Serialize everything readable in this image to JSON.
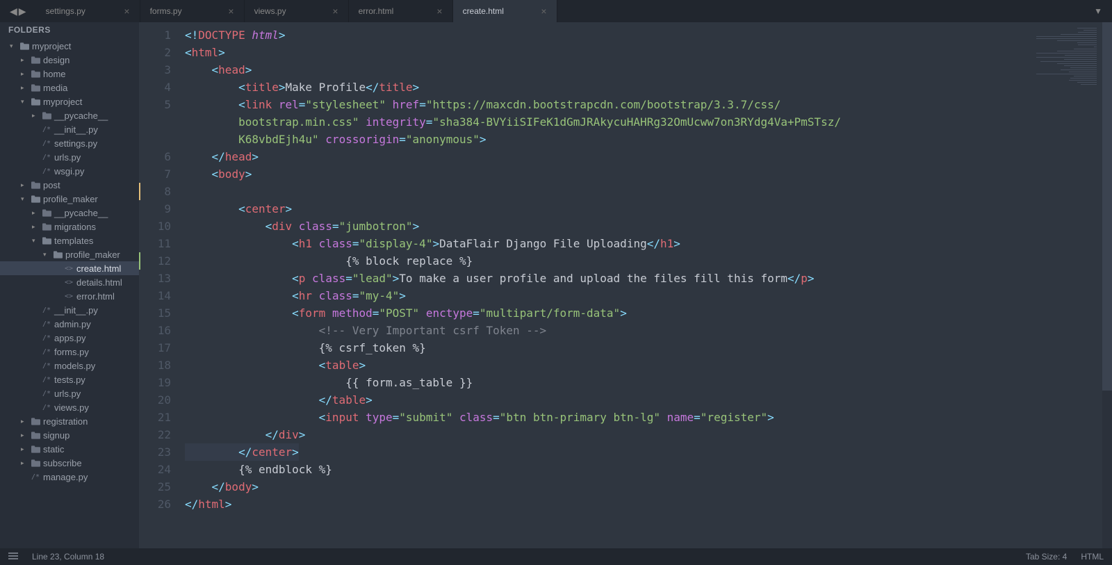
{
  "sidebar_title": "FOLDERS",
  "tabs": [
    {
      "label": "settings.py",
      "active": false
    },
    {
      "label": "forms.py",
      "active": false
    },
    {
      "label": "views.py",
      "active": false
    },
    {
      "label": "error.html",
      "active": false
    },
    {
      "label": "create.html",
      "active": true
    }
  ],
  "tree": [
    {
      "indent": 0,
      "arrow": "▾",
      "type": "folder-open",
      "label": "myproject"
    },
    {
      "indent": 1,
      "arrow": "▸",
      "type": "folder",
      "label": "design"
    },
    {
      "indent": 1,
      "arrow": "▸",
      "type": "folder",
      "label": "home"
    },
    {
      "indent": 1,
      "arrow": "▸",
      "type": "folder",
      "label": "media"
    },
    {
      "indent": 1,
      "arrow": "▾",
      "type": "folder-open",
      "label": "myproject"
    },
    {
      "indent": 2,
      "arrow": "▸",
      "type": "folder",
      "label": "__pycache__"
    },
    {
      "indent": 2,
      "arrow": "",
      "type": "py",
      "label": "__init__.py"
    },
    {
      "indent": 2,
      "arrow": "",
      "type": "py",
      "label": "settings.py"
    },
    {
      "indent": 2,
      "arrow": "",
      "type": "py",
      "label": "urls.py"
    },
    {
      "indent": 2,
      "arrow": "",
      "type": "py",
      "label": "wsgi.py"
    },
    {
      "indent": 1,
      "arrow": "▸",
      "type": "folder",
      "label": "post"
    },
    {
      "indent": 1,
      "arrow": "▾",
      "type": "folder-open",
      "label": "profile_maker"
    },
    {
      "indent": 2,
      "arrow": "▸",
      "type": "folder",
      "label": "__pycache__"
    },
    {
      "indent": 2,
      "arrow": "▸",
      "type": "folder",
      "label": "migrations"
    },
    {
      "indent": 2,
      "arrow": "▾",
      "type": "folder-open",
      "label": "templates"
    },
    {
      "indent": 3,
      "arrow": "▾",
      "type": "folder-open",
      "label": "profile_maker"
    },
    {
      "indent": 4,
      "arrow": "",
      "type": "html",
      "label": "create.html",
      "selected": true
    },
    {
      "indent": 4,
      "arrow": "",
      "type": "html",
      "label": "details.html"
    },
    {
      "indent": 4,
      "arrow": "",
      "type": "html",
      "label": "error.html"
    },
    {
      "indent": 2,
      "arrow": "",
      "type": "py",
      "label": "__init__.py"
    },
    {
      "indent": 2,
      "arrow": "",
      "type": "py",
      "label": "admin.py"
    },
    {
      "indent": 2,
      "arrow": "",
      "type": "py",
      "label": "apps.py"
    },
    {
      "indent": 2,
      "arrow": "",
      "type": "py",
      "label": "forms.py"
    },
    {
      "indent": 2,
      "arrow": "",
      "type": "py",
      "label": "models.py"
    },
    {
      "indent": 2,
      "arrow": "",
      "type": "py",
      "label": "tests.py"
    },
    {
      "indent": 2,
      "arrow": "",
      "type": "py",
      "label": "urls.py"
    },
    {
      "indent": 2,
      "arrow": "",
      "type": "py",
      "label": "views.py"
    },
    {
      "indent": 1,
      "arrow": "▸",
      "type": "folder",
      "label": "registration"
    },
    {
      "indent": 1,
      "arrow": "▸",
      "type": "folder",
      "label": "signup"
    },
    {
      "indent": 1,
      "arrow": "▸",
      "type": "folder",
      "label": "static"
    },
    {
      "indent": 1,
      "arrow": "▸",
      "type": "folder",
      "label": "subscribe"
    },
    {
      "indent": 1,
      "arrow": "",
      "type": "py",
      "label": "manage.py"
    }
  ],
  "line_count": 26,
  "gutter_marks": {
    "8": "yellow",
    "12": "green"
  },
  "highlight_line": 23,
  "code_lines": [
    [
      [
        "pun",
        "<!"
      ],
      [
        "tagn",
        "DOCTYPE "
      ],
      [
        "doct",
        "html"
      ],
      [
        "pun",
        ">"
      ]
    ],
    [
      [
        "pun",
        "<"
      ],
      [
        "tagn",
        "html"
      ],
      [
        "pun",
        ">"
      ]
    ],
    [
      [
        "txt",
        "    "
      ],
      [
        "pun",
        "<"
      ],
      [
        "tagn",
        "head"
      ],
      [
        "pun",
        ">"
      ]
    ],
    [
      [
        "txt",
        "        "
      ],
      [
        "pun",
        "<"
      ],
      [
        "tagn",
        "title"
      ],
      [
        "pun",
        ">"
      ],
      [
        "txt",
        "Make Profile"
      ],
      [
        "pun",
        "</"
      ],
      [
        "tagn",
        "title"
      ],
      [
        "pun",
        ">"
      ]
    ],
    [
      [
        "txt",
        "        "
      ],
      [
        "pun",
        "<"
      ],
      [
        "tagn",
        "link"
      ],
      [
        "txt",
        " "
      ],
      [
        "attr",
        "rel"
      ],
      [
        "pun",
        "="
      ],
      [
        "str",
        "\"stylesheet\""
      ],
      [
        "txt",
        " "
      ],
      [
        "attr",
        "href"
      ],
      [
        "pun",
        "="
      ],
      [
        "str",
        "\"https://maxcdn.bootstrapcdn.com/bootstrap/3.3.7/css/"
      ]
    ],
    [
      [
        "txt",
        "        "
      ],
      [
        "str",
        "bootstrap.min.css\""
      ],
      [
        "txt",
        " "
      ],
      [
        "attr",
        "integrity"
      ],
      [
        "pun",
        "="
      ],
      [
        "str",
        "\"sha384-BVYiiSIFeK1dGmJRAkycuHAHRg32OmUcww7on3RYdg4Va+PmSTsz/"
      ]
    ],
    [
      [
        "txt",
        "        "
      ],
      [
        "str",
        "K68vbdEjh4u\""
      ],
      [
        "txt",
        " "
      ],
      [
        "attr",
        "crossorigin"
      ],
      [
        "pun",
        "="
      ],
      [
        "str",
        "\"anonymous\""
      ],
      [
        "pun",
        ">"
      ]
    ],
    [
      [
        "txt",
        "    "
      ],
      [
        "pun",
        "</"
      ],
      [
        "tagn",
        "head"
      ],
      [
        "pun",
        ">"
      ]
    ],
    [
      [
        "txt",
        "    "
      ],
      [
        "pun",
        "<"
      ],
      [
        "tagn",
        "body"
      ],
      [
        "pun",
        ">"
      ]
    ],
    [],
    [
      [
        "txt",
        "        "
      ],
      [
        "pun",
        "<"
      ],
      [
        "tagn",
        "center"
      ],
      [
        "pun",
        ">"
      ]
    ],
    [
      [
        "txt",
        "            "
      ],
      [
        "pun",
        "<"
      ],
      [
        "tagn",
        "div"
      ],
      [
        "txt",
        " "
      ],
      [
        "attr",
        "class"
      ],
      [
        "pun",
        "="
      ],
      [
        "str",
        "\"jumbotron\""
      ],
      [
        "pun",
        ">"
      ]
    ],
    [
      [
        "txt",
        "                "
      ],
      [
        "pun",
        "<"
      ],
      [
        "tagn",
        "h1"
      ],
      [
        "txt",
        " "
      ],
      [
        "attr",
        "class"
      ],
      [
        "pun",
        "="
      ],
      [
        "str",
        "\"display-4\""
      ],
      [
        "pun",
        ">"
      ],
      [
        "txt",
        "DataFlair Django File Uploading"
      ],
      [
        "pun",
        "</"
      ],
      [
        "tagn",
        "h1"
      ],
      [
        "pun",
        ">"
      ]
    ],
    [
      [
        "txt",
        "                        "
      ],
      [
        "tmpl",
        "{% block replace %}"
      ]
    ],
    [
      [
        "txt",
        "                "
      ],
      [
        "pun",
        "<"
      ],
      [
        "tagn",
        "p"
      ],
      [
        "txt",
        " "
      ],
      [
        "attr",
        "class"
      ],
      [
        "pun",
        "="
      ],
      [
        "str",
        "\"lead\""
      ],
      [
        "pun",
        ">"
      ],
      [
        "txt",
        "To make a user profile and upload the files fill this form"
      ],
      [
        "pun",
        "</"
      ],
      [
        "tagn",
        "p"
      ],
      [
        "pun",
        ">"
      ]
    ],
    [
      [
        "txt",
        "                "
      ],
      [
        "pun",
        "<"
      ],
      [
        "tagn",
        "hr"
      ],
      [
        "txt",
        " "
      ],
      [
        "attr",
        "class"
      ],
      [
        "pun",
        "="
      ],
      [
        "str",
        "\"my-4\""
      ],
      [
        "pun",
        ">"
      ]
    ],
    [
      [
        "txt",
        "                "
      ],
      [
        "pun",
        "<"
      ],
      [
        "tagn",
        "form"
      ],
      [
        "txt",
        " "
      ],
      [
        "attr",
        "method"
      ],
      [
        "pun",
        "="
      ],
      [
        "str",
        "\"POST\""
      ],
      [
        "txt",
        " "
      ],
      [
        "attr",
        "enctype"
      ],
      [
        "pun",
        "="
      ],
      [
        "str",
        "\"multipart/form-data\""
      ],
      [
        "pun",
        ">"
      ]
    ],
    [
      [
        "txt",
        "                    "
      ],
      [
        "cmt",
        "<!-- Very Important csrf Token -->"
      ]
    ],
    [
      [
        "txt",
        "                    "
      ],
      [
        "tmpl",
        "{% csrf_token %}"
      ]
    ],
    [
      [
        "txt",
        "                    "
      ],
      [
        "pun",
        "<"
      ],
      [
        "tagn",
        "table"
      ],
      [
        "pun",
        ">"
      ]
    ],
    [
      [
        "txt",
        "                        "
      ],
      [
        "tmpl",
        "{{ form.as_table }}"
      ]
    ],
    [
      [
        "txt",
        "                    "
      ],
      [
        "pun",
        "</"
      ],
      [
        "tagn",
        "table"
      ],
      [
        "pun",
        ">"
      ]
    ],
    [
      [
        "txt",
        "                    "
      ],
      [
        "pun",
        "<"
      ],
      [
        "tagn",
        "input"
      ],
      [
        "txt",
        " "
      ],
      [
        "attr",
        "type"
      ],
      [
        "pun",
        "="
      ],
      [
        "str",
        "\"submit\""
      ],
      [
        "txt",
        " "
      ],
      [
        "attr",
        "class"
      ],
      [
        "pun",
        "="
      ],
      [
        "str",
        "\"btn btn-primary btn-lg\""
      ],
      [
        "txt",
        " "
      ],
      [
        "attr",
        "name"
      ],
      [
        "pun",
        "="
      ],
      [
        "str",
        "\"register\""
      ],
      [
        "pun",
        ">"
      ]
    ],
    [
      [
        "txt",
        "            "
      ],
      [
        "pun",
        "</"
      ],
      [
        "tagn",
        "div"
      ],
      [
        "pun",
        ">"
      ]
    ],
    [
      [
        "txt",
        "        "
      ],
      [
        "pun",
        "</"
      ],
      [
        "tagn",
        "center"
      ],
      [
        "pun",
        ">"
      ]
    ],
    [
      [
        "txt",
        "        "
      ],
      [
        "tmpl",
        "{% endblock %}"
      ]
    ],
    [
      [
        "txt",
        "    "
      ],
      [
        "pun",
        "</"
      ],
      [
        "tagn",
        "body"
      ],
      [
        "pun",
        ">"
      ]
    ],
    [
      [
        "pun",
        "</"
      ],
      [
        "tagn",
        "html"
      ],
      [
        "pun",
        ">"
      ]
    ]
  ],
  "code_line_map": [
    1,
    2,
    3,
    4,
    5,
    5,
    5,
    6,
    7,
    8,
    9,
    10,
    11,
    12,
    13,
    14,
    15,
    16,
    17,
    18,
    19,
    20,
    21,
    22,
    23,
    24,
    25,
    26
  ],
  "status": {
    "cursor": "Line 23, Column 18",
    "tab_size": "Tab Size: 4",
    "syntax": "HTML"
  }
}
